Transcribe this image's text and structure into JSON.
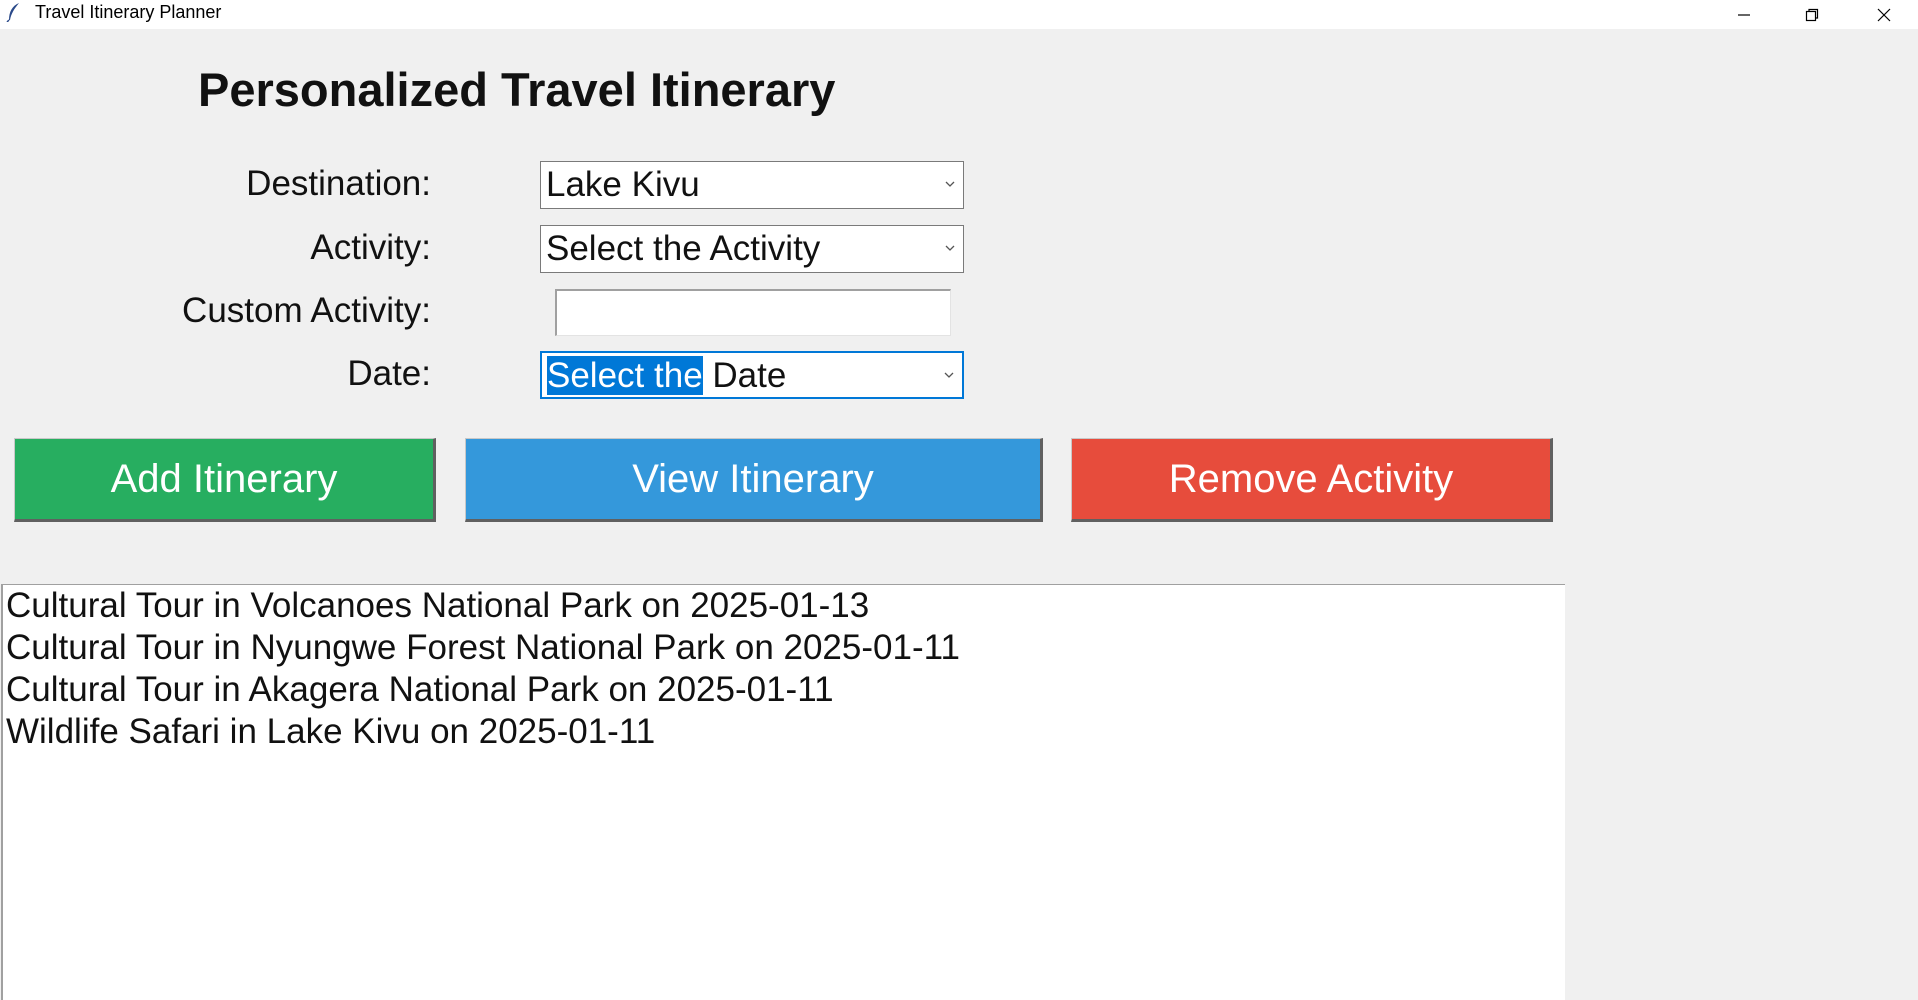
{
  "window": {
    "title": "Travel Itinerary Planner",
    "icons": {
      "app": "feather-icon",
      "minimize": "minimize-icon",
      "restore": "restore-icon",
      "close": "close-icon"
    }
  },
  "heading": "Personalized Travel Itinerary",
  "form": {
    "destination_label": "Destination:",
    "destination_value": "Lake Kivu",
    "activity_label": "Activity:",
    "activity_value": "Select the Activity",
    "custom_label": "Custom Activity:",
    "custom_value": "",
    "date_label": "Date:",
    "date_value_selected": "Select the",
    "date_value_rest": " Date"
  },
  "buttons": {
    "add": {
      "label": "Add Itinerary",
      "color": "#27ae60"
    },
    "view": {
      "label": "View Itinerary",
      "color": "#3498db"
    },
    "remove": {
      "label": "Remove Activity",
      "color": "#e74c3c"
    }
  },
  "itinerary": [
    "Cultural Tour in Volcanoes National Park on 2025-01-13",
    "Cultural Tour in Nyungwe Forest National Park on 2025-01-11",
    "Cultural Tour in Akagera National Park on 2025-01-11",
    "Wildlife Safari in Lake Kivu on 2025-01-11"
  ],
  "colors": {
    "background": "#f0f0f0",
    "selection": "#0078d7"
  }
}
